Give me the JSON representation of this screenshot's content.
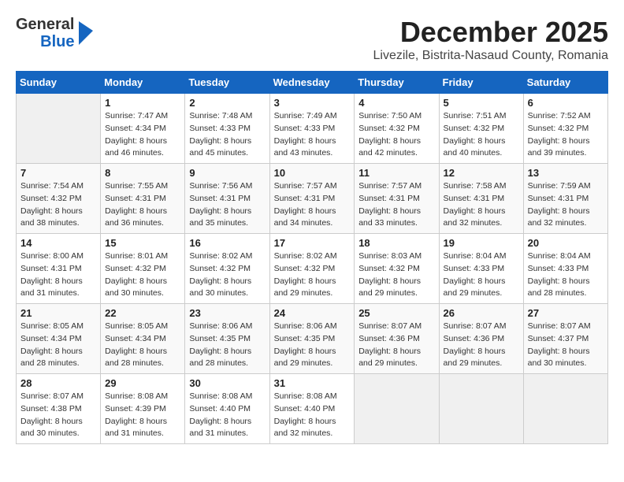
{
  "logo": {
    "general": "General",
    "blue": "Blue"
  },
  "header": {
    "month": "December 2025",
    "location": "Livezile, Bistrita-Nasaud County, Romania"
  },
  "weekdays": [
    "Sunday",
    "Monday",
    "Tuesday",
    "Wednesday",
    "Thursday",
    "Friday",
    "Saturday"
  ],
  "weeks": [
    [
      {
        "day": "",
        "info": ""
      },
      {
        "day": "1",
        "info": "Sunrise: 7:47 AM\nSunset: 4:34 PM\nDaylight: 8 hours\nand 46 minutes."
      },
      {
        "day": "2",
        "info": "Sunrise: 7:48 AM\nSunset: 4:33 PM\nDaylight: 8 hours\nand 45 minutes."
      },
      {
        "day": "3",
        "info": "Sunrise: 7:49 AM\nSunset: 4:33 PM\nDaylight: 8 hours\nand 43 minutes."
      },
      {
        "day": "4",
        "info": "Sunrise: 7:50 AM\nSunset: 4:32 PM\nDaylight: 8 hours\nand 42 minutes."
      },
      {
        "day": "5",
        "info": "Sunrise: 7:51 AM\nSunset: 4:32 PM\nDaylight: 8 hours\nand 40 minutes."
      },
      {
        "day": "6",
        "info": "Sunrise: 7:52 AM\nSunset: 4:32 PM\nDaylight: 8 hours\nand 39 minutes."
      }
    ],
    [
      {
        "day": "7",
        "info": "Sunrise: 7:54 AM\nSunset: 4:32 PM\nDaylight: 8 hours\nand 38 minutes."
      },
      {
        "day": "8",
        "info": "Sunrise: 7:55 AM\nSunset: 4:31 PM\nDaylight: 8 hours\nand 36 minutes."
      },
      {
        "day": "9",
        "info": "Sunrise: 7:56 AM\nSunset: 4:31 PM\nDaylight: 8 hours\nand 35 minutes."
      },
      {
        "day": "10",
        "info": "Sunrise: 7:57 AM\nSunset: 4:31 PM\nDaylight: 8 hours\nand 34 minutes."
      },
      {
        "day": "11",
        "info": "Sunrise: 7:57 AM\nSunset: 4:31 PM\nDaylight: 8 hours\nand 33 minutes."
      },
      {
        "day": "12",
        "info": "Sunrise: 7:58 AM\nSunset: 4:31 PM\nDaylight: 8 hours\nand 32 minutes."
      },
      {
        "day": "13",
        "info": "Sunrise: 7:59 AM\nSunset: 4:31 PM\nDaylight: 8 hours\nand 32 minutes."
      }
    ],
    [
      {
        "day": "14",
        "info": "Sunrise: 8:00 AM\nSunset: 4:31 PM\nDaylight: 8 hours\nand 31 minutes."
      },
      {
        "day": "15",
        "info": "Sunrise: 8:01 AM\nSunset: 4:32 PM\nDaylight: 8 hours\nand 30 minutes."
      },
      {
        "day": "16",
        "info": "Sunrise: 8:02 AM\nSunset: 4:32 PM\nDaylight: 8 hours\nand 30 minutes."
      },
      {
        "day": "17",
        "info": "Sunrise: 8:02 AM\nSunset: 4:32 PM\nDaylight: 8 hours\nand 29 minutes."
      },
      {
        "day": "18",
        "info": "Sunrise: 8:03 AM\nSunset: 4:32 PM\nDaylight: 8 hours\nand 29 minutes."
      },
      {
        "day": "19",
        "info": "Sunrise: 8:04 AM\nSunset: 4:33 PM\nDaylight: 8 hours\nand 29 minutes."
      },
      {
        "day": "20",
        "info": "Sunrise: 8:04 AM\nSunset: 4:33 PM\nDaylight: 8 hours\nand 28 minutes."
      }
    ],
    [
      {
        "day": "21",
        "info": "Sunrise: 8:05 AM\nSunset: 4:34 PM\nDaylight: 8 hours\nand 28 minutes."
      },
      {
        "day": "22",
        "info": "Sunrise: 8:05 AM\nSunset: 4:34 PM\nDaylight: 8 hours\nand 28 minutes."
      },
      {
        "day": "23",
        "info": "Sunrise: 8:06 AM\nSunset: 4:35 PM\nDaylight: 8 hours\nand 28 minutes."
      },
      {
        "day": "24",
        "info": "Sunrise: 8:06 AM\nSunset: 4:35 PM\nDaylight: 8 hours\nand 29 minutes."
      },
      {
        "day": "25",
        "info": "Sunrise: 8:07 AM\nSunset: 4:36 PM\nDaylight: 8 hours\nand 29 minutes."
      },
      {
        "day": "26",
        "info": "Sunrise: 8:07 AM\nSunset: 4:36 PM\nDaylight: 8 hours\nand 29 minutes."
      },
      {
        "day": "27",
        "info": "Sunrise: 8:07 AM\nSunset: 4:37 PM\nDaylight: 8 hours\nand 30 minutes."
      }
    ],
    [
      {
        "day": "28",
        "info": "Sunrise: 8:07 AM\nSunset: 4:38 PM\nDaylight: 8 hours\nand 30 minutes."
      },
      {
        "day": "29",
        "info": "Sunrise: 8:08 AM\nSunset: 4:39 PM\nDaylight: 8 hours\nand 31 minutes."
      },
      {
        "day": "30",
        "info": "Sunrise: 8:08 AM\nSunset: 4:40 PM\nDaylight: 8 hours\nand 31 minutes."
      },
      {
        "day": "31",
        "info": "Sunrise: 8:08 AM\nSunset: 4:40 PM\nDaylight: 8 hours\nand 32 minutes."
      },
      {
        "day": "",
        "info": ""
      },
      {
        "day": "",
        "info": ""
      },
      {
        "day": "",
        "info": ""
      }
    ]
  ]
}
